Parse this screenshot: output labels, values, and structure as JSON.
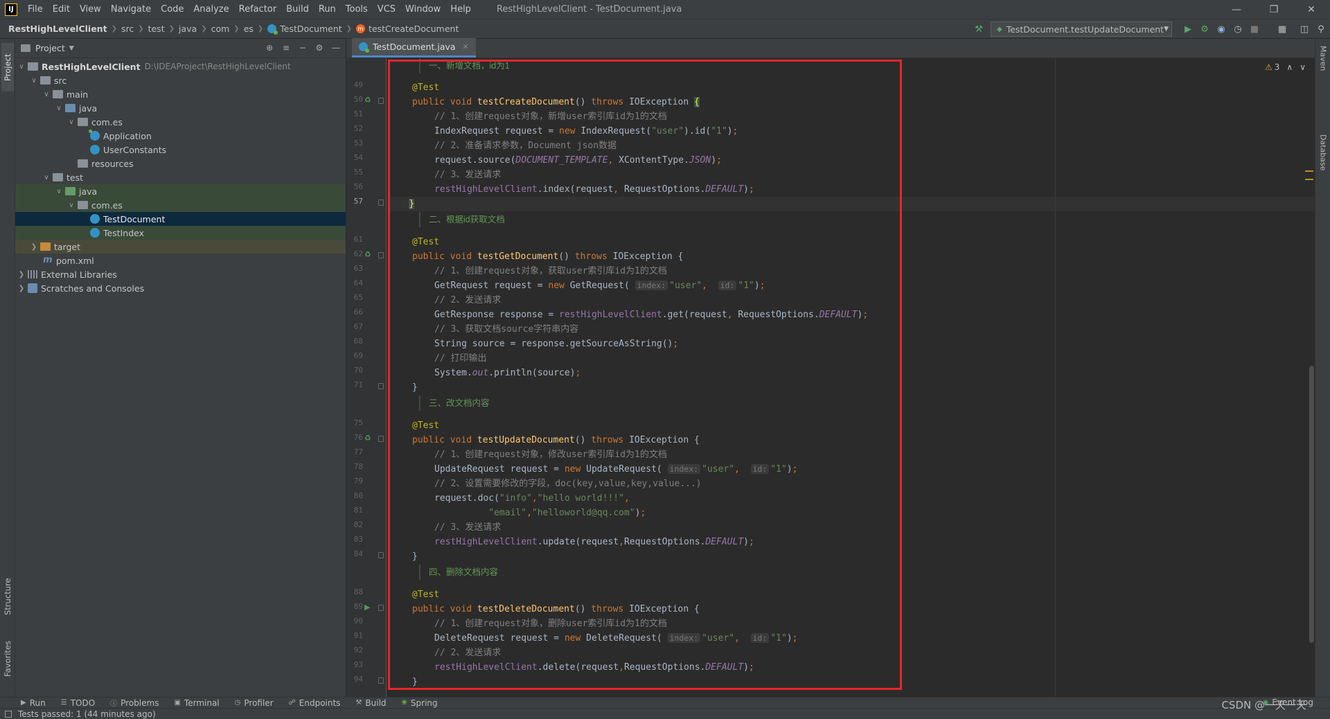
{
  "menubar": {
    "logo": "IJ",
    "items": [
      "File",
      "Edit",
      "View",
      "Navigate",
      "Code",
      "Analyze",
      "Refactor",
      "Build",
      "Run",
      "Tools",
      "VCS",
      "Window",
      "Help"
    ],
    "window_title": "RestHighLevelClient - TestDocument.java"
  },
  "navbar": {
    "crumbs": [
      "RestHighLevelClient",
      "src",
      "test",
      "java",
      "com",
      "es",
      "TestDocument",
      "testCreateDocument"
    ],
    "run_config": "TestDocument.testUpdateDocument"
  },
  "project_panel": {
    "title": "Project",
    "tree": [
      {
        "label": "RestHighLevelClient",
        "hint": "D:\\IDEAProject\\RestHighLevelClient"
      },
      {
        "label": "src"
      },
      {
        "label": "main"
      },
      {
        "label": "java"
      },
      {
        "label": "com.es"
      },
      {
        "label": "Application"
      },
      {
        "label": "UserConstants"
      },
      {
        "label": "resources"
      },
      {
        "label": "test"
      },
      {
        "label": "java"
      },
      {
        "label": "com.es"
      },
      {
        "label": "TestDocument"
      },
      {
        "label": "TestIndex"
      },
      {
        "label": "target"
      },
      {
        "label": "pom.xml"
      },
      {
        "label": "External Libraries"
      },
      {
        "label": "Scratches and Consoles"
      }
    ]
  },
  "left_strip": {
    "project": "Project",
    "structure": "Structure",
    "favorites": "Favorites"
  },
  "right_strip": {
    "maven": "Maven",
    "database": "Database"
  },
  "editor": {
    "tab_label": "TestDocument.java",
    "inspection_count": "3",
    "line_numbers": [
      "49",
      "50",
      "51",
      "52",
      "53",
      "54",
      "55",
      "56",
      "57",
      "61",
      "62",
      "63",
      "64",
      "65",
      "66",
      "67",
      "68",
      "69",
      "70",
      "71",
      "75",
      "76",
      "77",
      "78",
      "79",
      "80",
      "81",
      "82",
      "83",
      "84",
      "88",
      "89",
      "90",
      "91",
      "92",
      "93",
      "94"
    ],
    "docs": {
      "d1": "一、新增文档，id为1",
      "d2": "二、根据id获取文档",
      "d3": "三、改文档内容",
      "d4": "四、删除文档内容"
    },
    "comments": {
      "c51": "// 1、创建request对象，新增user索引库id为1的文档",
      "c53": "// 2、准备请求参数，Document json数据",
      "c55": "// 3、发送请求",
      "c63": "// 1、创建request对象，获取user索引库id为1的文档",
      "c65": "// 2、发送请求",
      "c67": "// 3、获取文档source字符串内容",
      "c69": "// 打印输出",
      "c77": "// 1、创建request对象，修改user索引库id为1的文档",
      "c79": "// 2、设置需要修改的字段，doc(key,value,key,value...)",
      "c82": "// 3、发送请求",
      "c90": "// 1、创建request对象，删除user索引库id为1的文档",
      "c92": "// 2、发送请求"
    },
    "methods": {
      "create": "testCreateDocument",
      "get": "testGetDocument",
      "update": "testUpdateDocument",
      "delete": "testDeleteDocument"
    }
  },
  "bottom_tools": [
    "Run",
    "TODO",
    "Problems",
    "Terminal",
    "Profiler",
    "Endpoints",
    "Build",
    "Spring"
  ],
  "event_log": "Event Log",
  "status": {
    "text": "Tests passed: 1 (44 minutes ago)",
    "watermark": "CSDN @一天一天"
  },
  "colors": {
    "keyword": "#cc7832",
    "annotation": "#bbb529",
    "method": "#ffc66d",
    "string": "#6a8759",
    "comment": "#808080",
    "doc": "#629755",
    "highlight_box": "#e8262b"
  }
}
